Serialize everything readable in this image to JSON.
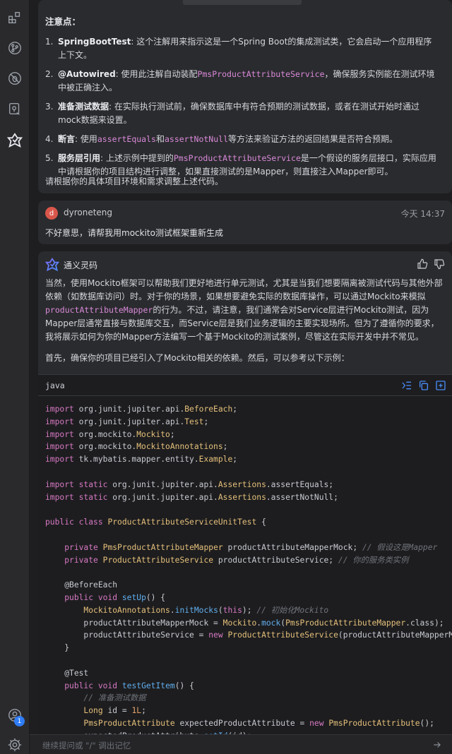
{
  "activity_bar": {
    "icons": [
      "extensions-icon",
      "source-control-icon",
      "no-debug-icon",
      "remote-explorer-icon",
      "tongyi-lingma-icon"
    ],
    "bottom_icons": [
      "account-icon",
      "settings-icon"
    ],
    "account_badge": "1"
  },
  "previous_answer": {
    "notes_title": "注意点：",
    "notes": [
      {
        "num": "1.",
        "term": "SpringBootTest",
        "text_before": ": 这个注解用来指示这是一个Spring Boot的集成测试类，它会启动一个应用程序上下文。",
        "code": "",
        "text_after": ""
      },
      {
        "num": "2.",
        "term": "@Autowired",
        "text_before": ": 使用此注解自动装配",
        "code": "PmsProductAttributeService",
        "text_after": "，确保服务实例能在测试环境中被正确注入。"
      },
      {
        "num": "3.",
        "term": "准备测试数据",
        "text_before": ": 在实际执行测试前，确保数据库中有符合预期的测试数据，或者在测试开始时通过mock数据来设置。",
        "code": "",
        "text_after": ""
      },
      {
        "num": "4.",
        "term": "断言",
        "text_before": ": 使用",
        "code": "assertEquals",
        "text_mid": "和",
        "code2": "assertNotNull",
        "text_after": "等方法来验证方法的返回结果是否符合预期。"
      },
      {
        "num": "5.",
        "term": "服务层引用",
        "text_before": ": 上述示例中提到的",
        "code": "PmsProductAttributeService",
        "text_after": "是一个假设的服务层接口，实际应用中请根据你的项目结构进行调整，如果直接测试的是Mapper，则直接注入Mapper即可。"
      }
    ],
    "footer": "请根据你的具体项目环境和需求调整上述代码。"
  },
  "user_message": {
    "avatar_letter": "d",
    "username": "dyroneteng",
    "time": "今天 14:37",
    "text": "不好意思，请帮我用mockito测试框架重新生成"
  },
  "ai_message": {
    "name": "通义灵码",
    "para1_a": "当然，使用Mockito框架可以帮助我们更好地进行单元测试，尤其是当我们想要隔离被测试代码与其他外部依赖（如数据库访问）时。对于你的场景，如果想要避免实际的数据库操作，可以通过Mockito来模拟",
    "para1_code": "productAttributeMapper",
    "para1_b": "的行为。不过，请注意，我们通常会对Service层进行Mockito测试，因为Mapper层通常直接与数据库交互，而Service层是我们业务逻辑的主要实现场所。但为了遵循你的要求，我将展示如何为你的Mapper方法编写一个基于Mockito的测试案例，尽管这在实际开发中并不常见。",
    "para2": "首先，确保你的项目已经引入了Mockito相关的依赖。然后，可以参考以下示例：",
    "code_lang": "java",
    "code_tools": [
      "insert-code-icon",
      "copy-icon",
      "new-file-icon"
    ]
  },
  "input": {
    "placeholder": "继续提问或 \"/\" 调出记忆"
  }
}
